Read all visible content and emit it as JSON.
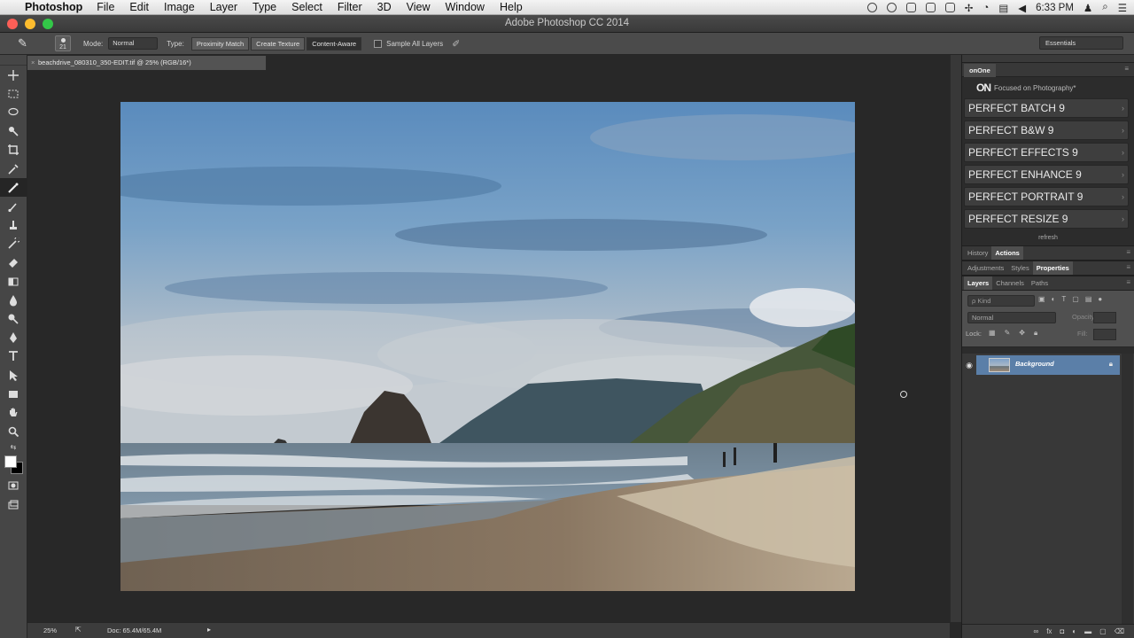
{
  "menubar": {
    "app": "Photoshop",
    "items": [
      "File",
      "Edit",
      "Image",
      "Layer",
      "Type",
      "Select",
      "Filter",
      "3D",
      "View",
      "Window",
      "Help"
    ],
    "clock": "6:33 PM"
  },
  "window": {
    "title": "Adobe Photoshop CC 2014"
  },
  "options": {
    "brush_size": "21",
    "mode_label": "Mode:",
    "mode_value": "Normal",
    "type_label": "Type:",
    "type_options": [
      "Proximity Match",
      "Create Texture",
      "Content-Aware"
    ],
    "selected_type": "Content-Aware",
    "sample_all_layers": "Sample All Layers",
    "workspace": "Essentials"
  },
  "document": {
    "tab_title": "beachdrive_080310_350-EDIT.tif @ 25% (RGB/16*)",
    "close_glyph": "×"
  },
  "status": {
    "zoom": "25%",
    "doc_size": "Doc: 65.4M/65.4M"
  },
  "onone": {
    "tab": "onOne",
    "tagline": "Focused on Photography*",
    "products": [
      "PERFECT BATCH 9",
      "PERFECT B&W 9",
      "PERFECT EFFECTS 9",
      "PERFECT ENHANCE 9",
      "PERFECT PORTRAIT 9",
      "PERFECT RESIZE 9"
    ],
    "refresh": "refresh"
  },
  "panels": {
    "history_tabs": [
      "History",
      "Actions"
    ],
    "adjust_tabs": [
      "Adjustments",
      "Styles",
      "Properties"
    ],
    "layers_tabs": [
      "Layers",
      "Channels",
      "Paths"
    ],
    "kind": "ρ Kind",
    "blend_mode": "Normal",
    "opacity_label": "Opacity:",
    "lock_label": "Lock:",
    "fill_label": "Fill:",
    "layer_name": "Background"
  }
}
